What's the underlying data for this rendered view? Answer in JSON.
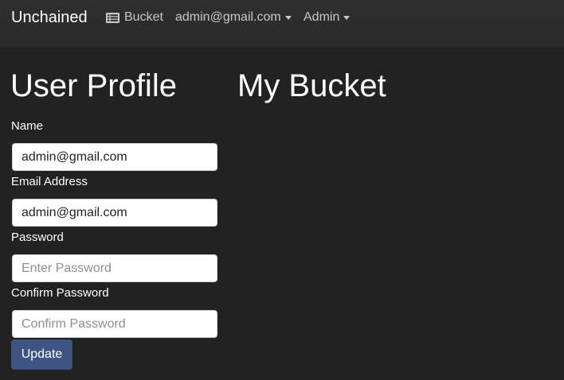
{
  "navbar": {
    "brand": "Unchained",
    "links": [
      {
        "label": "Bucket",
        "icon": "list-icon"
      },
      {
        "label": "admin@gmail.com",
        "dropdown": true
      },
      {
        "label": "Admin",
        "dropdown": true
      }
    ]
  },
  "profile": {
    "heading": "User Profile",
    "fields": [
      {
        "label": "Name",
        "value": "admin@gmail.com",
        "placeholder": ""
      },
      {
        "label": "Email Address",
        "value": "admin@gmail.com",
        "placeholder": ""
      },
      {
        "label": "Password",
        "value": "",
        "placeholder": "Enter Password"
      },
      {
        "label": "Confirm Password",
        "value": "",
        "placeholder": "Confirm Password"
      }
    ],
    "submit_label": "Update"
  },
  "bucket": {
    "heading": "My Bucket"
  },
  "colors": {
    "background": "#222222",
    "navbar": "#2f2f2f",
    "button": "#3e5583"
  }
}
